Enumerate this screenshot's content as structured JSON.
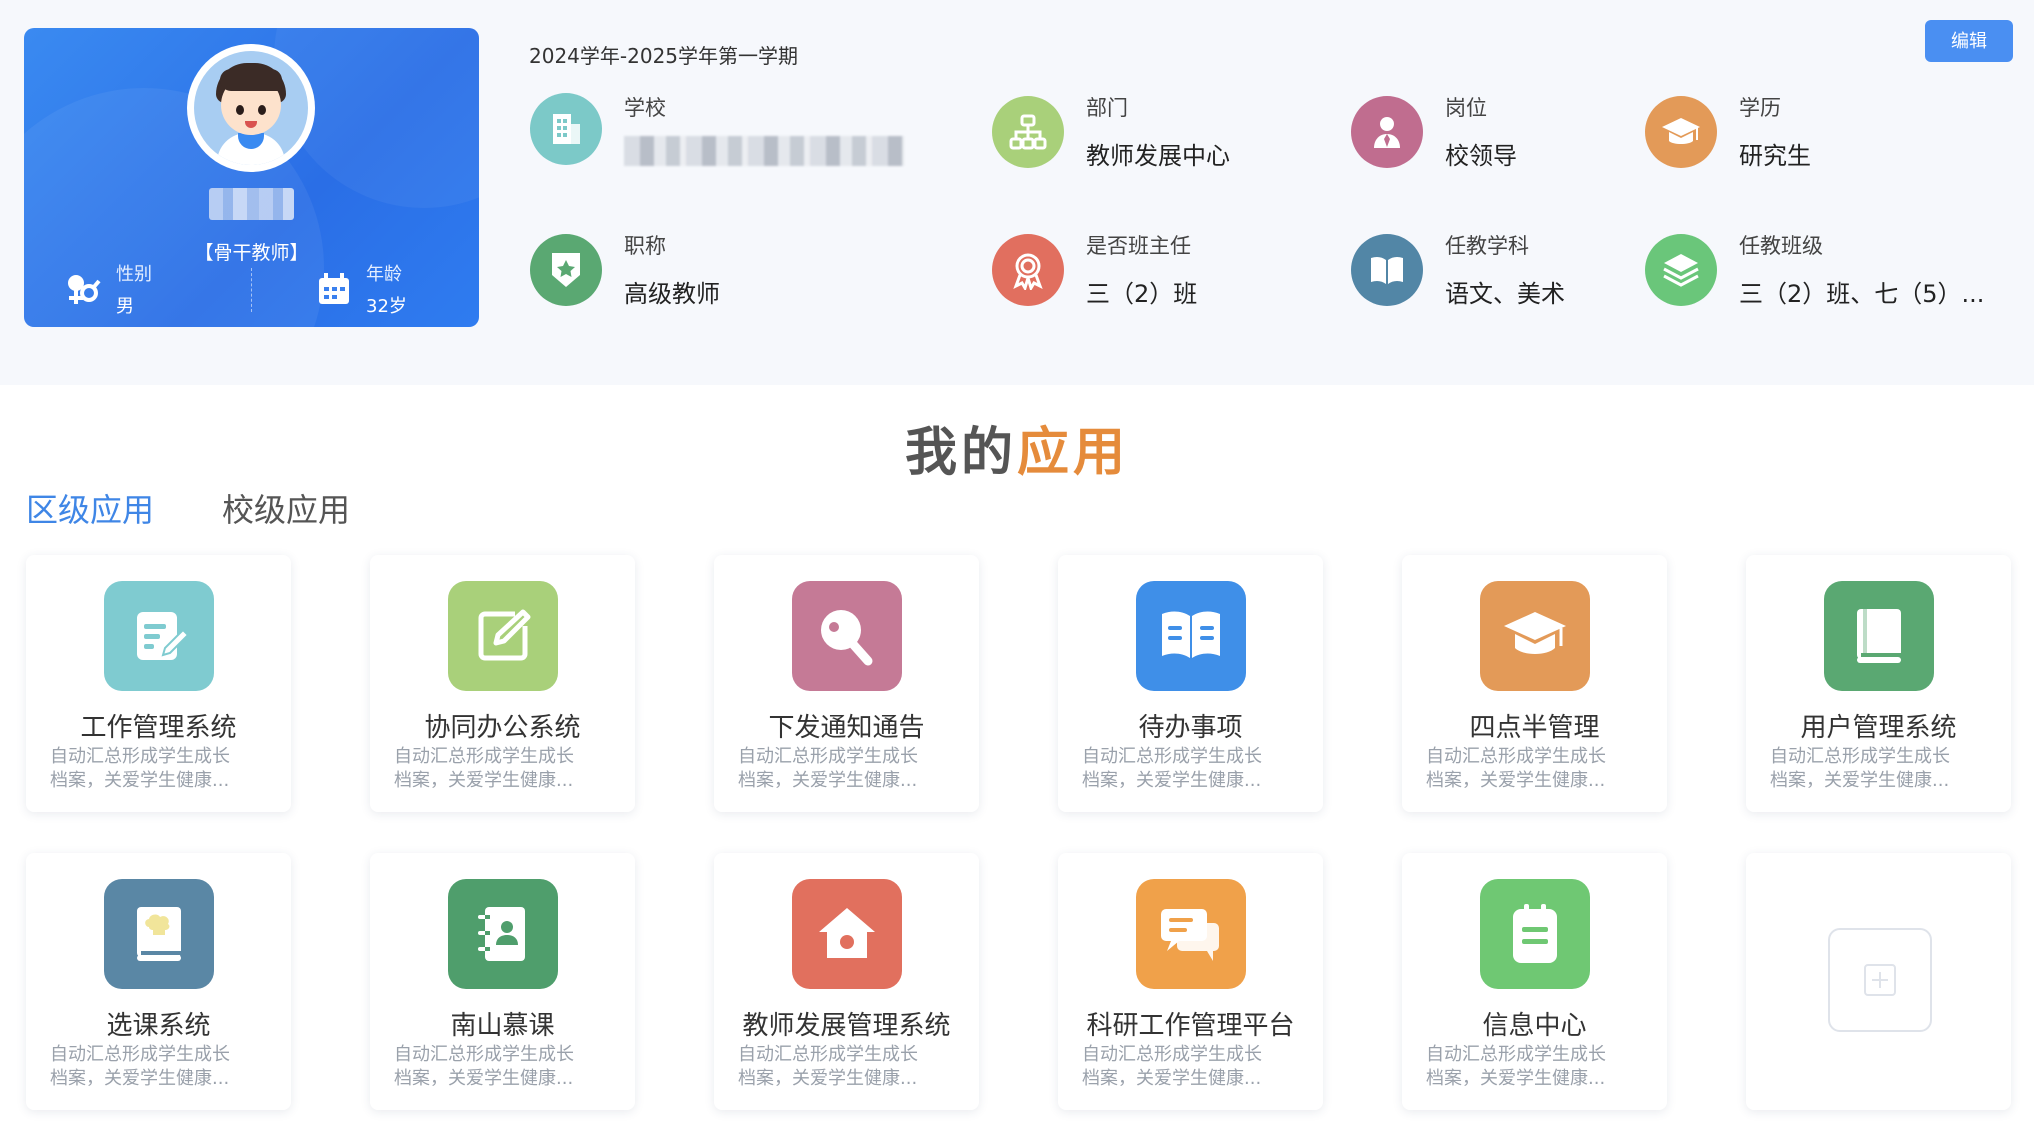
{
  "header": {
    "term": "2024学年-2025学年第一学期",
    "edit_label": "编辑"
  },
  "profile": {
    "role": "【骨干教师】",
    "gender_label": "性别",
    "gender_value": "男",
    "age_label": "年龄",
    "age_value": "32岁"
  },
  "info": {
    "school": {
      "label": "学校",
      "color": "#7cc9c8",
      "icon": "building-icon"
    },
    "department": {
      "label": "部门",
      "value": "教师发展中心",
      "color": "#a9d07a",
      "icon": "org-chart-icon"
    },
    "post": {
      "label": "岗位",
      "value": "校领导",
      "color": "#c06d8f",
      "icon": "person-tie-icon"
    },
    "education": {
      "label": "学历",
      "value": "研究生",
      "color": "#e39a58",
      "icon": "graduation-cap-icon"
    },
    "title": {
      "label": "职称",
      "value": "高级教师",
      "color": "#5aa872",
      "icon": "star-badge-icon"
    },
    "head_teacher": {
      "label": "是否班主任",
      "value": "三（2）班",
      "color": "#e16f5f",
      "icon": "award-ribbon-icon"
    },
    "subjects": {
      "label": "任教学科",
      "value": "语文、美术",
      "color": "#5286a6",
      "icon": "open-book-icon"
    },
    "classes": {
      "label": "任教班级",
      "value": "三（2）班、七（5）...",
      "color": "#6ac67a",
      "icon": "layers-icon"
    }
  },
  "apps_section": {
    "title_part1": "我的",
    "title_part2": "应用",
    "tabs": [
      "区级应用",
      "校级应用"
    ]
  },
  "apps": [
    {
      "name": "工作管理系统",
      "desc1": "自动汇总形成学生成长",
      "desc2": "档案，关爱学生健康...",
      "color": "#7fcbd0",
      "icon": "document-edit-icon"
    },
    {
      "name": "协同办公系统",
      "desc1": "自动汇总形成学生成长",
      "desc2": "档案，关爱学生健康...",
      "color": "#a9d07a",
      "icon": "pencil-square-icon"
    },
    {
      "name": "下发通知通告",
      "desc1": "自动汇总形成学生成长",
      "desc2": "档案，关爱学生健康...",
      "color": "#c57a96",
      "icon": "ping-pong-icon"
    },
    {
      "name": "待办事项",
      "desc1": "自动汇总形成学生成长",
      "desc2": "档案，关爱学生健康...",
      "color": "#3f8fe8",
      "icon": "open-book-list-icon"
    },
    {
      "name": "四点半管理",
      "desc1": "自动汇总形成学生成长",
      "desc2": "档案，关爱学生健康...",
      "color": "#e39a58",
      "icon": "graduation-cap-icon"
    },
    {
      "name": "用户管理系统",
      "desc1": "自动汇总形成学生成长",
      "desc2": "档案，关爱学生健康...",
      "color": "#5aa872",
      "icon": "book-icon"
    },
    {
      "name": "选课系统",
      "desc1": "自动汇总形成学生成长",
      "desc2": "档案，关爱学生健康...",
      "color": "#5a87a5",
      "icon": "chef-book-icon"
    },
    {
      "name": "南山慕课",
      "desc1": "自动汇总形成学生成长",
      "desc2": "档案，关爱学生健康...",
      "color": "#4f9e6c",
      "icon": "contact-book-icon"
    },
    {
      "name": "教师发展管理系统",
      "desc1": "自动汇总形成学生成长",
      "desc2": "档案，关爱学生健康...",
      "color": "#e1705e",
      "icon": "home-icon"
    },
    {
      "name": "科研工作管理平台",
      "desc1": "自动汇总形成学生成长",
      "desc2": "档案，关爱学生健康...",
      "color": "#f0a14a",
      "icon": "chat-bubbles-icon"
    },
    {
      "name": "信息中心",
      "desc1": "自动汇总形成学生成长",
      "desc2": "档案，关爱学生健康...",
      "color": "#6fc873",
      "icon": "clipboard-icon"
    }
  ]
}
